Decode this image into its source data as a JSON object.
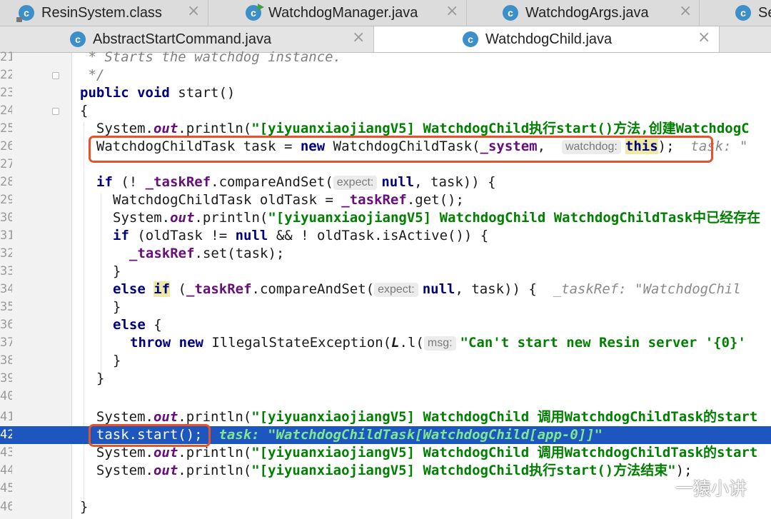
{
  "tabs_row1": [
    {
      "label": "ResinSystem.class",
      "icon": "class-file-locked-icon",
      "active": false
    },
    {
      "label": "WatchdogManager.java",
      "icon": "class-run-icon",
      "active": false
    },
    {
      "label": "WatchdogArgs.java",
      "icon": "class-icon",
      "active": false
    },
    {
      "label": "Se",
      "icon": "class-icon",
      "active": false
    }
  ],
  "tabs_row2": [
    {
      "label": "AbstractStartCommand.java",
      "icon": "class-icon",
      "active": false
    },
    {
      "label": "WatchdogChild.java",
      "icon": "class-icon",
      "active": true
    }
  ],
  "icon_glyph": "c",
  "close_glyph": "×",
  "gutter_numbers": [
    "21",
    "22",
    "23",
    "24",
    "25",
    "26",
    "27",
    "28",
    "29",
    "30",
    "31",
    "32",
    "33",
    "34",
    "35",
    "36",
    "37",
    "38",
    "39",
    "40",
    "41",
    "42",
    "43",
    "44",
    "45",
    "46"
  ],
  "code_lines": {
    "l21_comment": " * Starts the watchdog instance.",
    "l22_comment": " */",
    "l23_kw_public": "public",
    "l23_kw_void": "void",
    "l23_rest": " start()",
    "l24": "{",
    "l25_a": "  System.",
    "l25_out": "out",
    "l25_b": ".println(",
    "l25_str": "\"[yiyuanxiaojiangV5] WatchdogChild执行start()方法,创建WatchdogC",
    "l26_a": "  WatchdogChildTask task = ",
    "l26_new": "new",
    "l26_b": " WatchdogChildTask(",
    "l26_fld": "_system",
    "l26_c": ",  ",
    "l26_hint": "watchdog:",
    "l26_this": "this",
    "l26_d": ");",
    "l26_inline": "  task: \"",
    "l28_if": "if",
    "l28_a": " (! ",
    "l28_fld": "_taskRef",
    "l28_b": ".compareAndSet(",
    "l28_hint": "expect:",
    "l28_null": "null",
    "l28_c": ", task)) {",
    "l29_a": "WatchdogChildTask oldTask = ",
    "l29_fld": "_taskRef",
    "l29_b": ".get();",
    "l30_a": "System.",
    "l30_out": "out",
    "l30_b": ".println(",
    "l30_str": "\"[yiyuanxiaojiangV5] WatchdogChild WatchdogChildTask中已经存在",
    "l31_if": "if",
    "l31_a": " (oldTask != ",
    "l31_null": "null",
    "l31_b": " && ! oldTask.isActive()) {",
    "l32_fld": "_taskRef",
    "l32_a": ".set(task);",
    "l33": "}",
    "l34_else": "else",
    "l34_if": "if",
    "l34_a": " (",
    "l34_fld": "_taskRef",
    "l34_b": ".compareAndSet(",
    "l34_hint": "expect:",
    "l34_null": "null",
    "l34_c": ", task)) {",
    "l34_inline": "  _taskRef: \"WatchdogChil",
    "l35": "}",
    "l36_else": "else",
    "l36_a": " {",
    "l37_throw": "throw",
    "l37_new": "new",
    "l37_a": " IllegalStateException(",
    "l37_L": "L",
    "l37_b": ".l(",
    "l37_hint": "msg:",
    "l37_str": "\"Can't start new Resin server '{0}'",
    "l38": "}",
    "l39": "}",
    "l41_a": "  System.",
    "l41_out": "out",
    "l41_b": ".println(",
    "l41_str": "\"[yiyuanxiaojiangV5] WatchdogChild 调用WatchdogChildTask的start",
    "l42_code": "  task.start();",
    "l42_inline": "  task: \"WatchdogChildTask[WatchdogChild[app-0]]\"",
    "l43_a": "  System.",
    "l43_out": "out",
    "l43_b": ".println(",
    "l43_str": "\"[yiyuanxiaojiangV5] WatchdogChild 调用WatchdogChildTask的start",
    "l44_a": "  System.",
    "l44_out": "out",
    "l44_b": ".println(",
    "l44_str": "\"[yiyuanxiaojiangV5] WatchdogChild执行start()方法结束\"",
    "l44_c": ");",
    "l46": "}"
  },
  "watermark": "一猿小讲",
  "colors": {
    "current_line": "#1e56c0",
    "highlight_box": "#e5532a",
    "keyword": "#000080",
    "string": "#008000",
    "field": "#660e7a"
  }
}
